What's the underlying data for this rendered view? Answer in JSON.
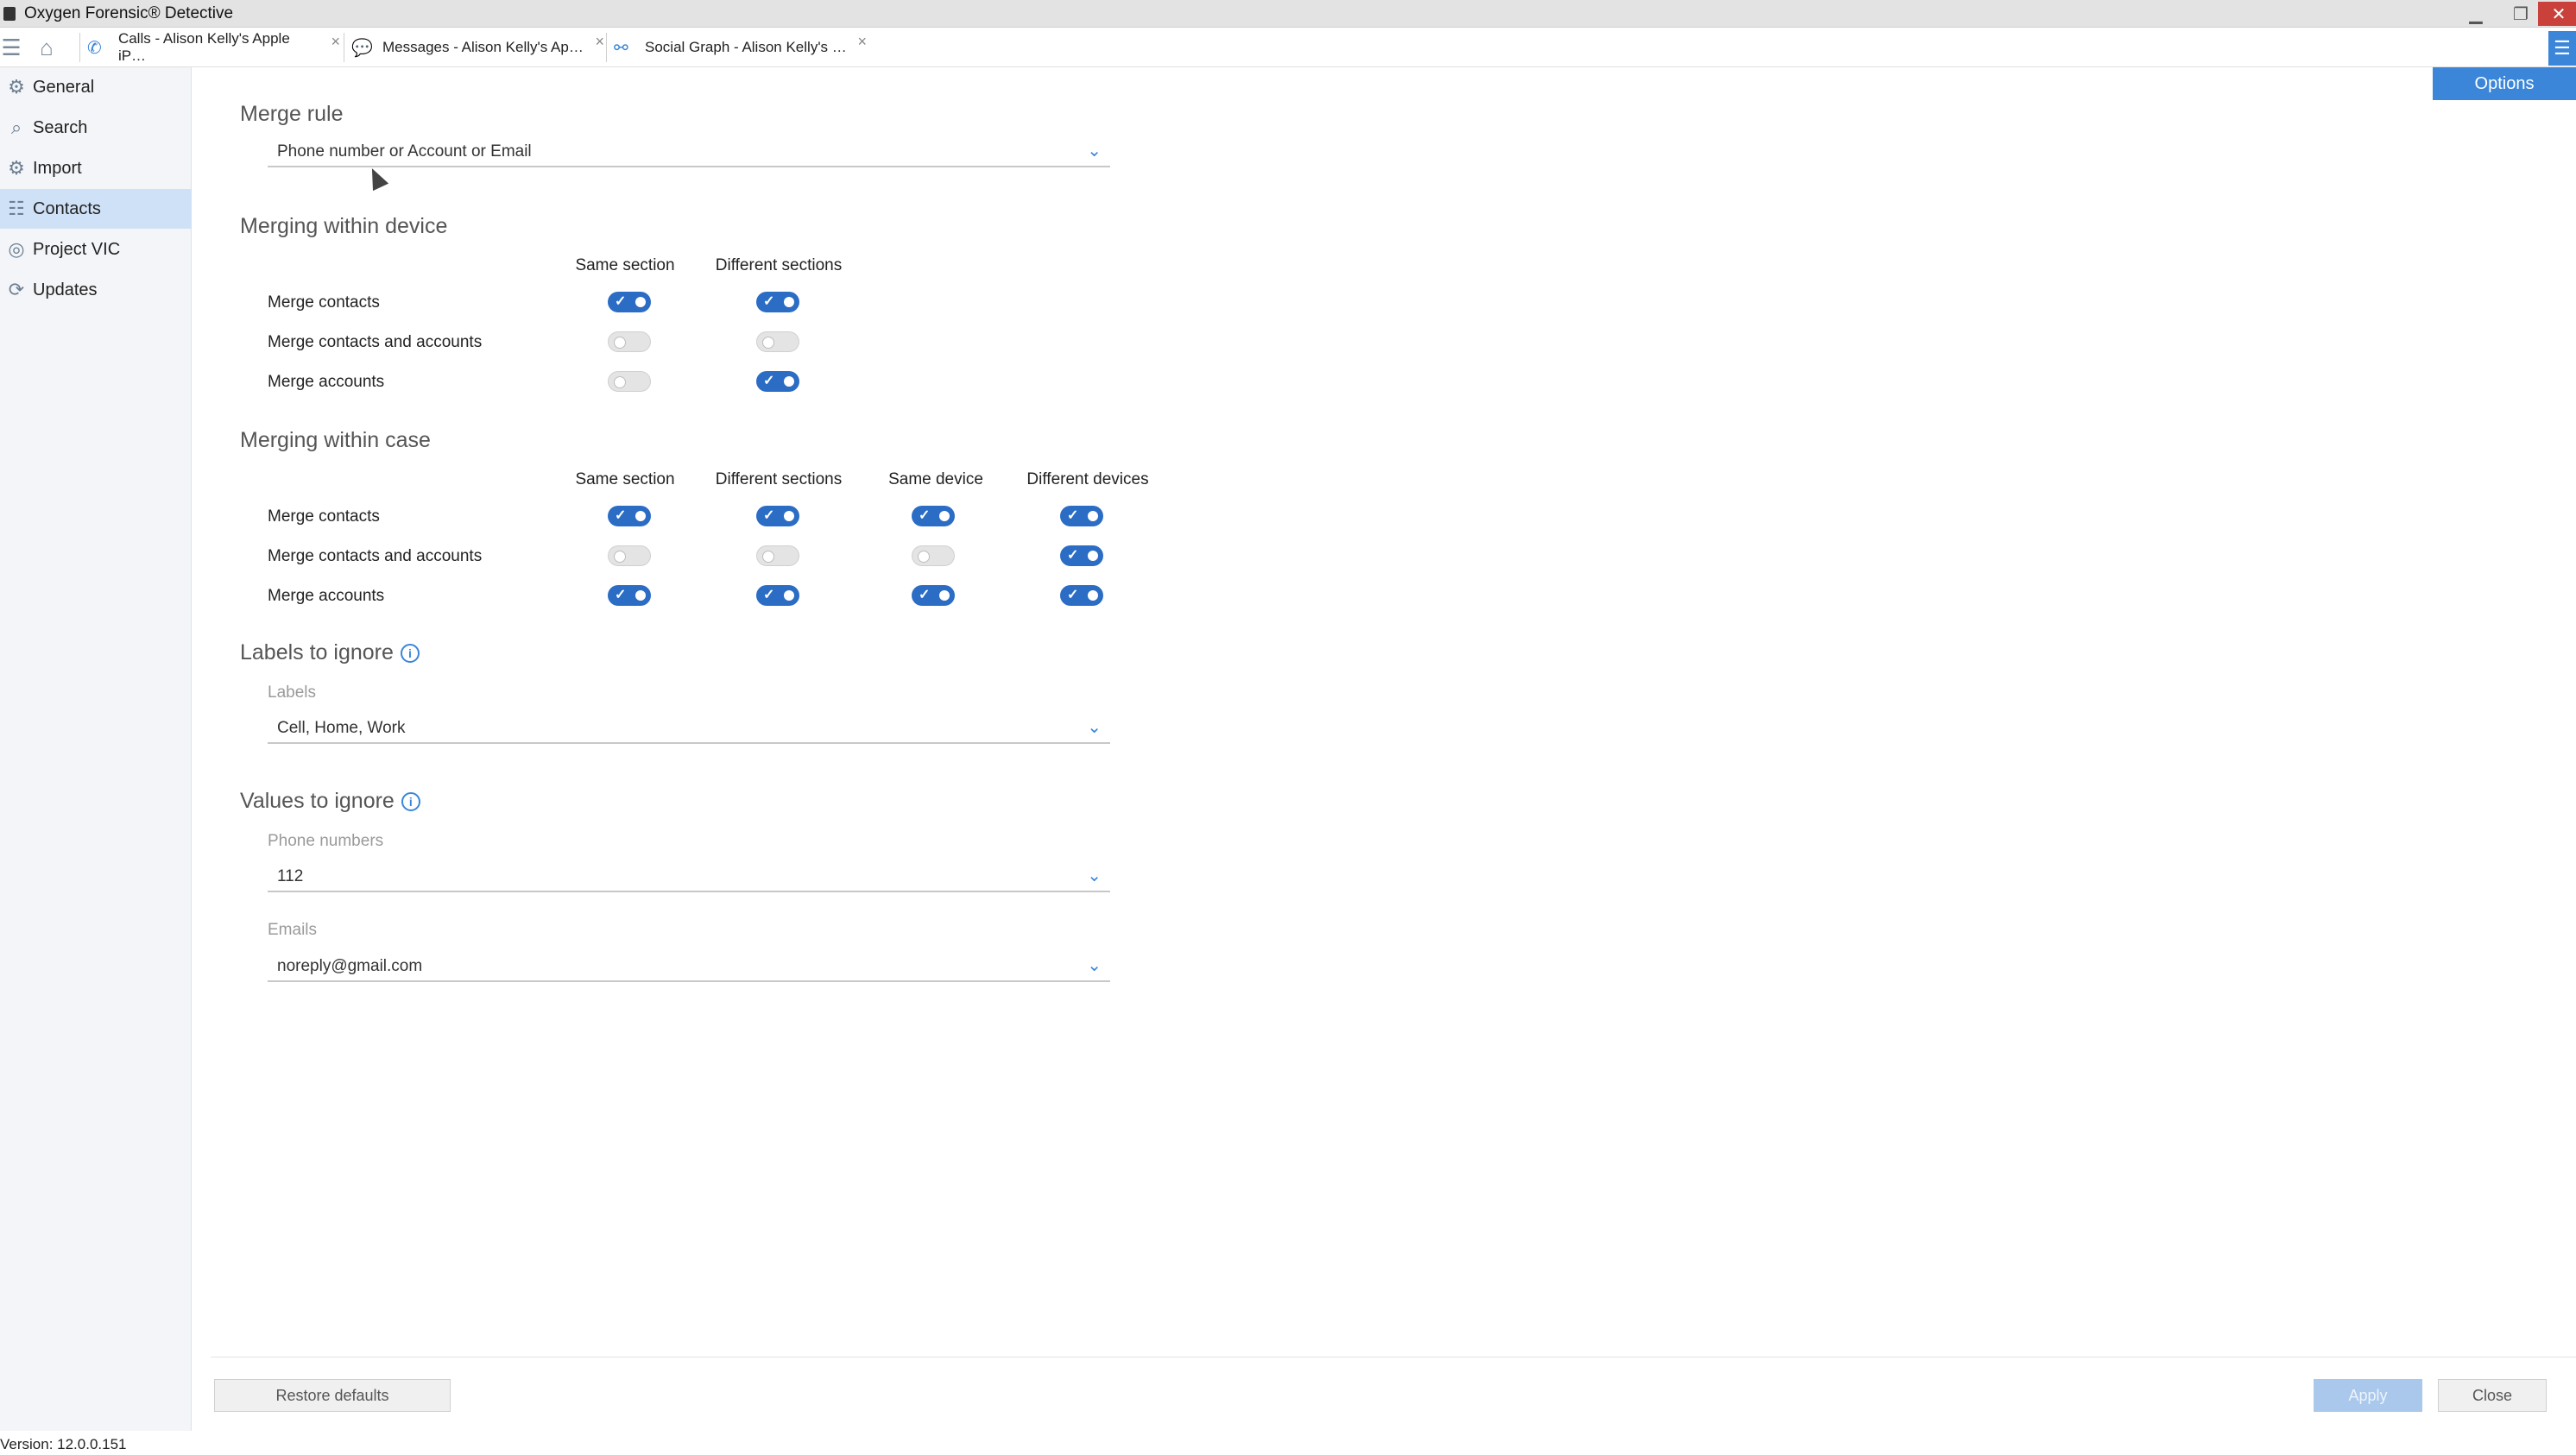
{
  "app": {
    "title": "Oxygen Forensic® Detective",
    "version": "Version: 12.0.0.151"
  },
  "tabs": [
    {
      "label": "Calls - Alison Kelly's Apple iP…",
      "icon": "phone-icon"
    },
    {
      "label": "Messages - Alison Kelly's Ap…",
      "icon": "message-icon"
    },
    {
      "label": "Social Graph - Alison Kelly's …",
      "icon": "graph-icon"
    }
  ],
  "sidebar": {
    "items": [
      {
        "label": "General",
        "icon": "gear-icon"
      },
      {
        "label": "Search",
        "icon": "search-icon"
      },
      {
        "label": "Import",
        "icon": "gear-icon"
      },
      {
        "label": "Contacts",
        "icon": "contacts-icon",
        "active": true
      },
      {
        "label": "Project VIC",
        "icon": "target-icon"
      },
      {
        "label": "Updates",
        "icon": "refresh-icon"
      }
    ]
  },
  "options_label": "Options",
  "merge_rule": {
    "heading": "Merge rule",
    "value": "Phone number or Account or Email"
  },
  "within_device": {
    "heading": "Merging within device",
    "columns": [
      "Same section",
      "Different sections"
    ],
    "rows": [
      {
        "label": "Merge contacts",
        "values": [
          true,
          true
        ]
      },
      {
        "label": "Merge contacts and accounts",
        "values": [
          false,
          false
        ]
      },
      {
        "label": "Merge accounts",
        "values": [
          false,
          true
        ]
      }
    ]
  },
  "within_case": {
    "heading": "Merging within case",
    "columns": [
      "Same section",
      "Different sections",
      "Same device",
      "Different devices"
    ],
    "rows": [
      {
        "label": "Merge contacts",
        "values": [
          true,
          true,
          true,
          true
        ]
      },
      {
        "label": "Merge contacts and accounts",
        "values": [
          false,
          false,
          false,
          true
        ]
      },
      {
        "label": "Merge accounts",
        "values": [
          true,
          true,
          true,
          true
        ]
      }
    ]
  },
  "labels_to_ignore": {
    "heading": "Labels to ignore",
    "field_label": "Labels",
    "value": "Cell, Home, Work"
  },
  "values_to_ignore": {
    "heading": "Values to ignore",
    "phone_label": "Phone numbers",
    "phone_value": "112",
    "email_label": "Emails",
    "email_value": "noreply@gmail.com"
  },
  "footer": {
    "restore": "Restore defaults",
    "apply": "Apply",
    "close": "Close"
  },
  "colors": {
    "accent": "#3b86d8",
    "toggle_on": "#2b6cc4",
    "sidebar_active": "#cfe1f7"
  }
}
